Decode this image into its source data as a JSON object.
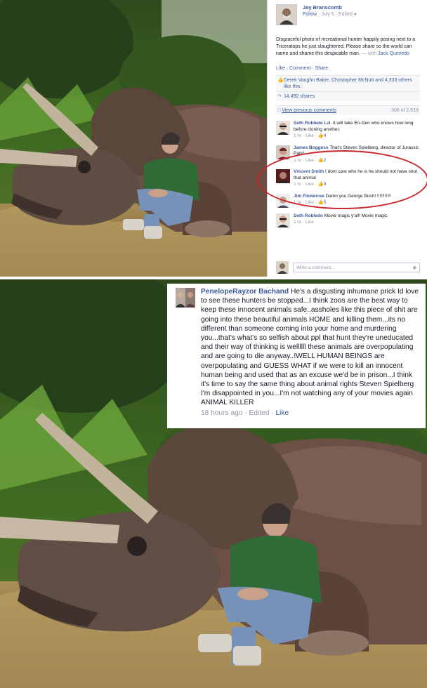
{
  "post": {
    "author": "Jay Branscomb",
    "follow_label": "Follow",
    "date_text": "July 6 · Edited",
    "body": "Disgraceful photo of recreational hunter happily posing next to a Triceratops he just slaughtered. Please share so the world can name and shame this despicable man.",
    "with_text": "— with",
    "tagged": "Jack Quevedo",
    "actions": "Like · Comment · Share",
    "likes_text": "Derek Vaughn Baker, Christopher McNutt and 4,333 others like this.",
    "shares_text": "14,492 shares",
    "view_previous": "View previous comments",
    "comment_count": "306 of 2,618",
    "write_placeholder": "Write a comment..."
  },
  "comments": [
    {
      "name": "Seth Robledo",
      "text": "Lol. It will take En-Gen who knows how long before cloning another.",
      "meta": "1 hr · Like · ",
      "likes": "4"
    },
    {
      "name": "James Boggess",
      "text": "That's Steven Spielberg, director of Jurassic Park!",
      "meta": "1 hr · Like · ",
      "likes": "2"
    },
    {
      "name": "Vincent Smith",
      "text": "I dont care who he is he should not have shot that animal",
      "meta": "1 hr · Like · ",
      "likes": "9"
    },
    {
      "name": "Jim Flowerree",
      "text": "Damn you George Bush! !!!!!!!!!!!",
      "meta": "1 hr · Like · ",
      "likes": "5"
    },
    {
      "name": "Seth Robledo",
      "text": "Movie magic y'all! Movie magic.",
      "meta": "1 hr · Like",
      "likes": ""
    }
  ],
  "overlay": {
    "name": "PenelopeRayzor Bachand",
    "text": "He's a disgusting inhumane prick Id love to see these hunters be stopped...I think zoos are the best way to keep these innocent animals safe..assholes like this piece of shit are going into these beautiful animals HOME and killing them...its no different than someone coming into your home and murdering you...that's what's so selfish about ppl that hunt they're uneducated and their way of thinking is wellllll these animals are overpopulating and are going to die anyway..!WELL HUMAN BEINGS are overpopulating and GUESS WHAT if we were to kill an innocent human being and used that as an excuse we'd be in prison...I think it's time to say the same thing about animal rights Steven Spielberg I'm disappointed in you...I'm not watching any of your movies again ANIMAL KILLER",
    "time": "18 hours ago · Edited · ",
    "like_label": "Like"
  },
  "icons": {
    "like": "thumbs-up-icon",
    "share": "share-icon",
    "camera": "camera-icon",
    "globe": "globe-icon"
  },
  "colors": {
    "link": "#3b5998",
    "muted": "#9197a3",
    "highlight_circle": "#c9262d"
  }
}
